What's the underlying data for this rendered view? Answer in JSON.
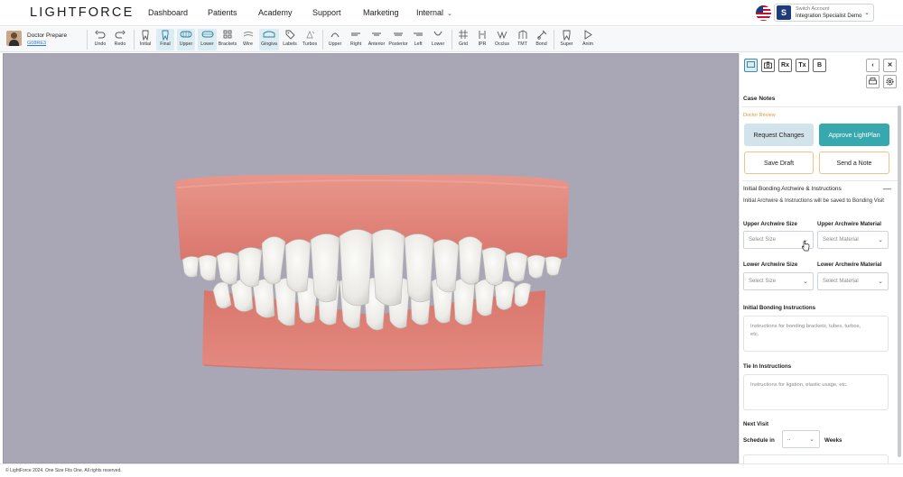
{
  "brand": {
    "logo_text": "LIGHTFORCE"
  },
  "nav": {
    "items": [
      "Dashboard",
      "Patients",
      "Academy",
      "Support",
      "Marketing",
      "Internal"
    ],
    "internal_has_dropdown": true
  },
  "account": {
    "initial": "S",
    "label": "Switch Account",
    "name": "Integration Specialist Demo"
  },
  "doctor": {
    "name": "Doctor Prepare",
    "code": "G08RE3"
  },
  "toolbar": {
    "undo": "Undo",
    "redo": "Redo",
    "initial": "Initial",
    "final": "Final",
    "upper": "Upper",
    "lower": "Lower",
    "brackets": "Brackets",
    "wire": "Wire",
    "gingiva": "Gingiva",
    "labels": "Labels",
    "turbos": "Turbos",
    "view_upper": "Upper",
    "view_right": "Right",
    "view_anterior": "Anterior",
    "view_posterior": "Posterior",
    "view_left": "Left",
    "view_lower": "Lower",
    "grid": "Grid",
    "ipr": "IPR",
    "occlus": "Occlus",
    "tmt": "TMT",
    "bond": "Bond",
    "super": "Super",
    "anim": "Anim"
  },
  "panel": {
    "tabs": {
      "rx": "Rx",
      "tx": "Tx",
      "b": "B"
    },
    "case_notes_title": "Case Notes",
    "doctor_review": "Doctor Review",
    "request_changes": "Request Changes",
    "approve": "Approve LightPlan",
    "save_draft": "Save Draft",
    "send_note": "Send a Note",
    "archwire_title": "Initial Bonding Archwire & Instructions",
    "archwire_desc": "Initial Archwire & Instructions will be saved to Bonding Visit",
    "upper_size_label": "Upper Archwire Size",
    "upper_material_label": "Upper Archwire Material",
    "lower_size_label": "Lower Archwire Size",
    "lower_material_label": "Lower Archwire Material",
    "select_size": "Select Size",
    "select_material": "Select Material",
    "bonding_instr_label": "Initial Bonding Instructions",
    "bonding_instr_placeholder": "Instructions for bonding brackets, tubes, turbos, etc.",
    "tiein_label": "Tie In Instructions",
    "tiein_placeholder": "Instructions for ligation, elastic usage, etc.",
    "next_visit_title": "Next Visit",
    "schedule_in": "Schedule in",
    "schedule_value": "..",
    "weeks": "Weeks"
  },
  "footer": {
    "copyright": "© LightForce 2024. One Size Fits One. All rights reserved."
  },
  "colors": {
    "accent_teal": "#37a8ad",
    "request_bg": "#d3e3ec",
    "review_orange": "#e8962b",
    "viewport_bg": "#a9a7b5",
    "gum": "#e48a80",
    "tooth": "#f3f2ee",
    "link_blue": "#2a7bd8"
  }
}
